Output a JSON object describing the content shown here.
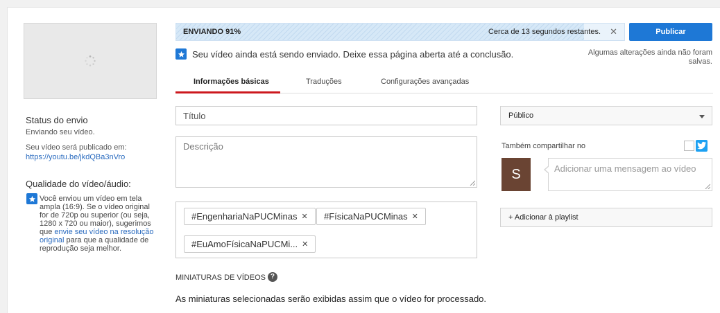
{
  "upload": {
    "progress_label": "ENVIANDO 91%",
    "progress_percent": 91,
    "time_remaining": "Cerca de 13 segundos restantes.",
    "publish_label": "Publicar",
    "info_message": "Seu vídeo ainda está sendo enviado. Deixe essa página aberta até a conclusão.",
    "unsaved_notice": "Algumas alterações ainda não foram salvas."
  },
  "sidebar": {
    "status_title": "Status do envio",
    "status_text": "Enviando seu vídeo.",
    "publish_at_label": "Seu vídeo será publicado em:",
    "video_url": "https://youtu.be/jkdQBa3nVro",
    "quality_title": "Qualidade do vídeo/áudio:",
    "quality_text_1": "Você enviou um vídeo em tela ampla (16:9). Se o vídeo original for de 720p ou superior (ou seja, 1280 x 720 ou maior), sugerimos que ",
    "quality_link": "envie seu vídeo na resolução original",
    "quality_text_2": " para que a qualidade de reprodução seja melhor."
  },
  "tabs": [
    {
      "label": "Informações básicas",
      "active": true
    },
    {
      "label": "Traduções",
      "active": false
    },
    {
      "label": "Configurações avançadas",
      "active": false
    }
  ],
  "form": {
    "title_placeholder": "Título",
    "description_placeholder": "Descrição",
    "tags": [
      "#EngenhariaNaPUCMinas",
      "#FísicaNaPUCMinas",
      "#EuAmoFísicaNaPUCMi..."
    ],
    "thumbnails_title": "MINIATURAS DE VÍDEOS",
    "thumbnails_desc": "As miniaturas selecionadas serão exibidas assim que o vídeo for processado."
  },
  "right": {
    "privacy_value": "Público",
    "share_label": "Também compartilhar no",
    "avatar_letter": "S",
    "message_placeholder": "Adicionar uma mensagem ao vídeo",
    "playlist_label": "+ Adicionar à playlist"
  },
  "colors": {
    "primary_blue": "#1e78d6",
    "tab_active": "#cc181e",
    "avatar_bg": "#6a4433",
    "twitter": "#1da1f2"
  }
}
